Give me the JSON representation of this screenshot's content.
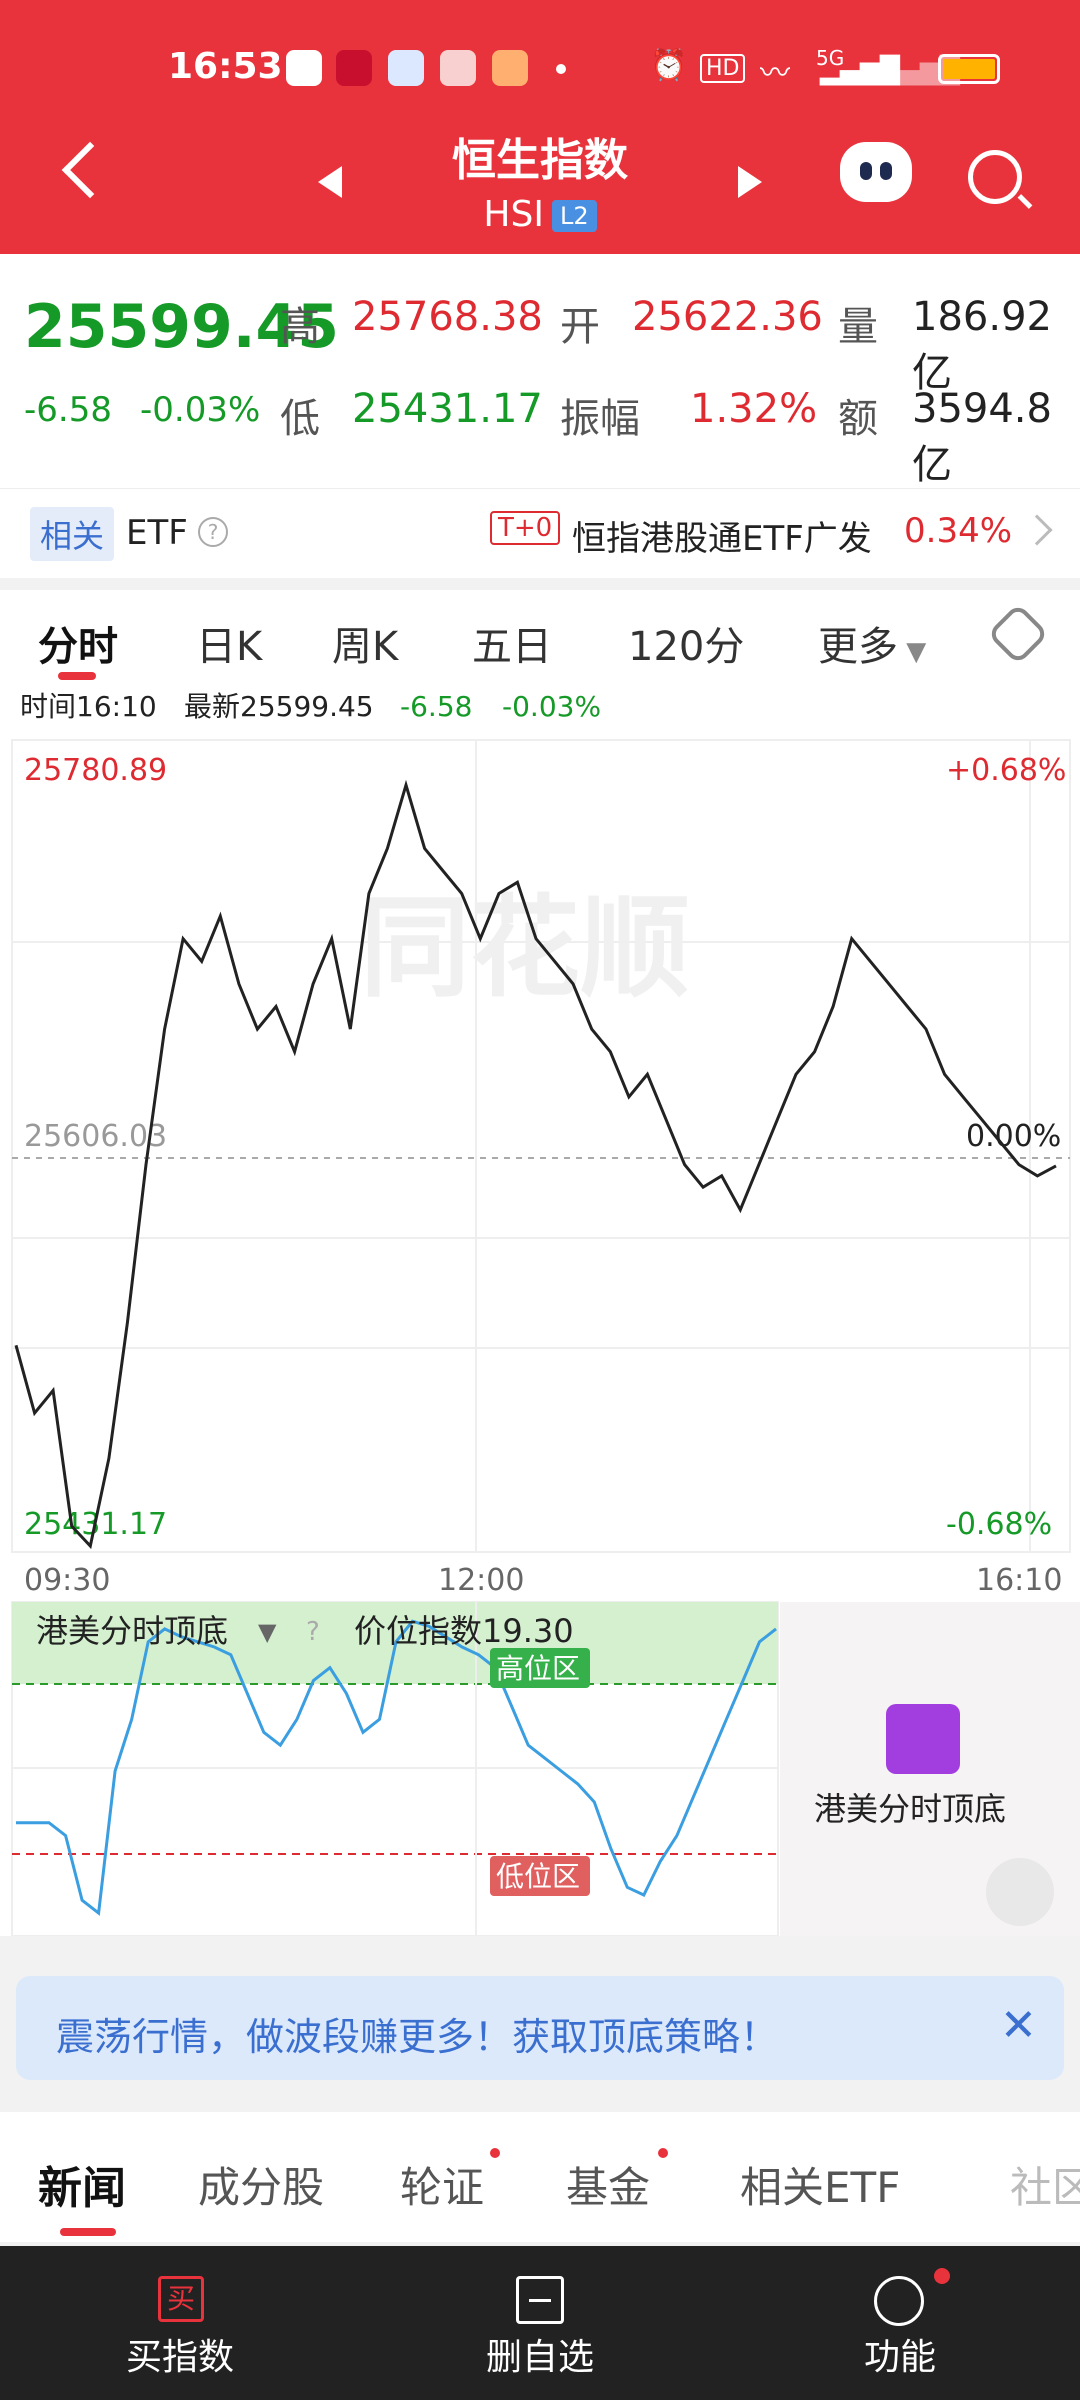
{
  "status_bar": {
    "time": "16:53",
    "network": "5G"
  },
  "header": {
    "title": "恒生指数",
    "code": "HSI",
    "badge": "L2"
  },
  "quote": {
    "price": "25599.45",
    "change": "-6.58",
    "change_pct": "-0.03%",
    "high_label": "高",
    "high": "25768.38",
    "open_label": "开",
    "open": "25622.36",
    "vol_label": "量",
    "vol": "186.92亿",
    "low_label": "低",
    "low": "25431.17",
    "amp_label": "振幅",
    "amp": "1.32%",
    "amt_label": "额",
    "amt": "3594.8亿"
  },
  "etf": {
    "tag": "相关",
    "label": "ETF",
    "t0": "T+0",
    "name": "恒指港股通ETF广发",
    "pct": "0.34%"
  },
  "tabs": [
    {
      "label": "分时"
    },
    {
      "label": "日K"
    },
    {
      "label": "周K"
    },
    {
      "label": "五日"
    },
    {
      "label": "120分"
    },
    {
      "label": "更多"
    }
  ],
  "infobar": {
    "time_label": "时间16:10",
    "latest": "最新25599.45",
    "chg": "-6.58",
    "chg_pct": "-0.03%"
  },
  "chart_labels": {
    "y_max": "25780.89",
    "y_min": "25431.17",
    "pct_top": "+0.68%",
    "pct_bottom": "-0.68%",
    "pct_mid": "0.00%",
    "baseline": "25606.03",
    "x_start": "09:30",
    "x_mid": "12:00",
    "x_end": "16:10",
    "watermark": "同花顺"
  },
  "chart_data": {
    "type": "line",
    "ylim": [
      25431.17,
      25780.89
    ],
    "baseline": 25606.03,
    "x_labels": [
      "09:30",
      "12:00",
      "16:10"
    ],
    "series": [
      {
        "values": [
          25520,
          25490,
          25500,
          25440,
          25431.17,
          25470,
          25530,
          25600,
          25660,
          25700,
          25690,
          25710,
          25680,
          25660,
          25670,
          25650,
          25680,
          25700,
          25660,
          25720,
          25740,
          25768,
          25740,
          25730,
          25720,
          25700,
          25720,
          25725,
          25700,
          25690,
          25680,
          25660,
          25650,
          25630,
          25640,
          25620,
          25600,
          25590,
          25595,
          25580,
          25600,
          25620,
          25640,
          25650,
          25670,
          25700,
          25690,
          25680,
          25670,
          25660,
          25640,
          25630,
          25620,
          25610,
          25600,
          25595,
          25599.45
        ]
      }
    ]
  },
  "indicator": {
    "name": "港美分时顶底",
    "index_label": "价位指数19.30",
    "high_zone": "高位区",
    "low_zone": "低位区",
    "side_label": "港美分时顶底",
    "values": [
      20,
      20,
      20,
      15,
      -10,
      -15,
      40,
      60,
      90,
      95,
      92,
      90,
      88,
      85,
      70,
      55,
      50,
      60,
      75,
      80,
      70,
      55,
      60,
      90,
      98,
      96,
      92,
      88,
      85,
      80,
      65,
      50,
      45,
      40,
      35,
      28,
      10,
      -5,
      -8,
      5,
      15,
      30,
      45,
      60,
      75,
      90,
      95
    ]
  },
  "banner": {
    "text": "震荡行情，做波段赚更多！获取顶底策略！"
  },
  "news_tabs": [
    {
      "label": "新闻"
    },
    {
      "label": "成分股"
    },
    {
      "label": "轮证"
    },
    {
      "label": "基金"
    },
    {
      "label": "相关ETF"
    },
    {
      "label": "社区"
    }
  ],
  "bottom_nav": [
    {
      "label": "买指数",
      "icon": "买"
    },
    {
      "label": "删自选"
    },
    {
      "label": "功能"
    }
  ]
}
